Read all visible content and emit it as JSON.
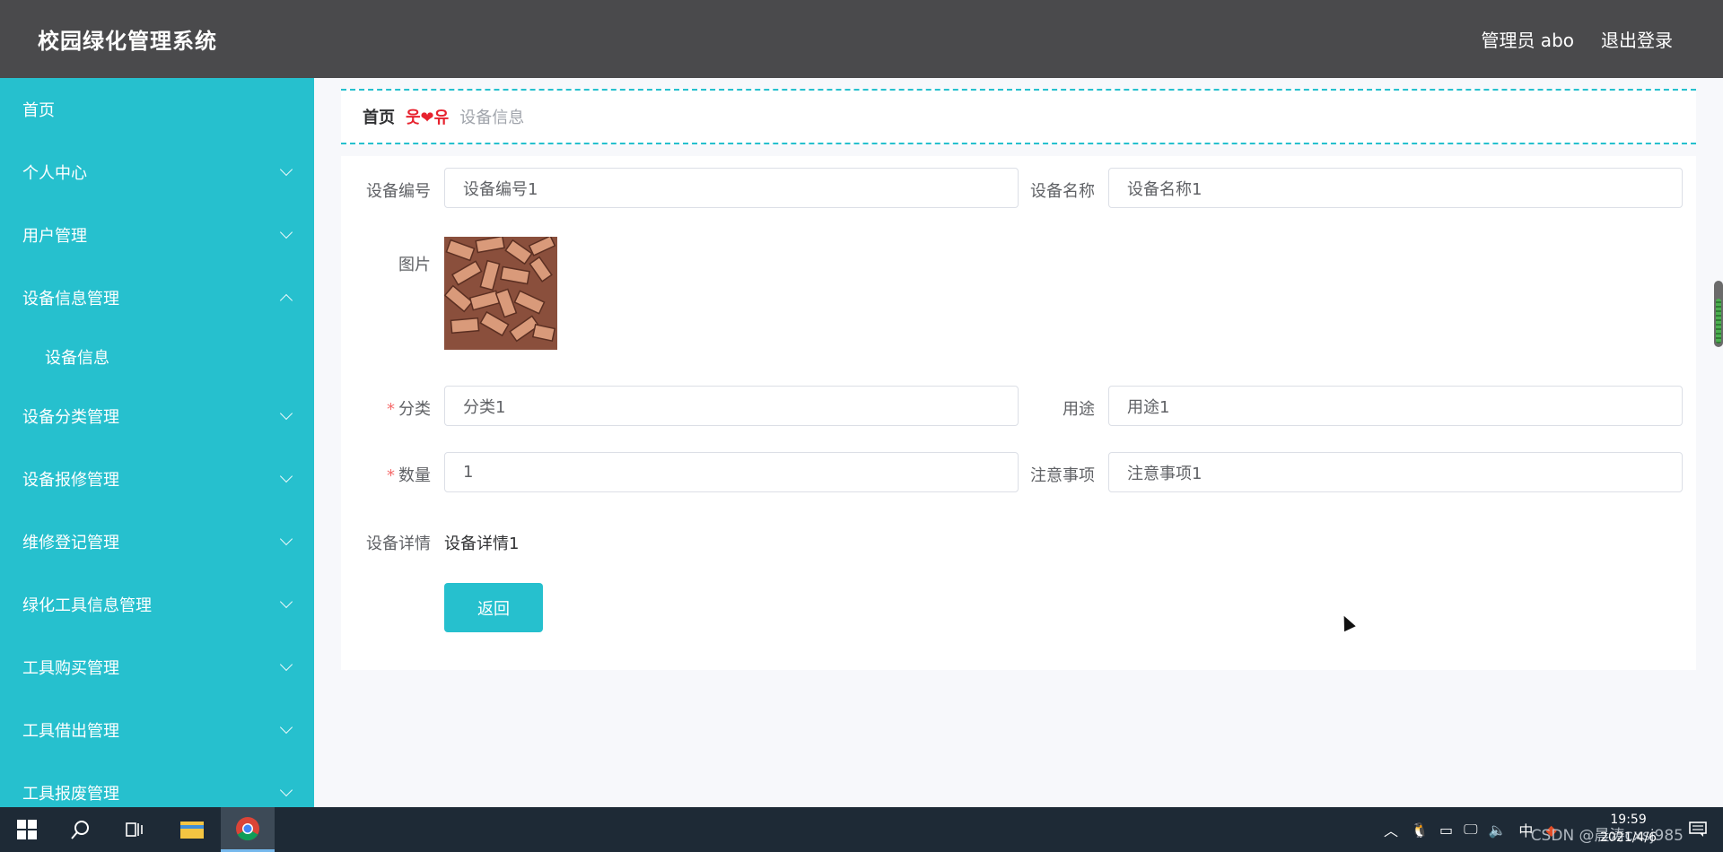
{
  "header": {
    "app_title": "校园绿化管理系统",
    "user_info": "管理员 abo",
    "logout": "退出登录"
  },
  "sidebar": {
    "items": [
      {
        "label": "首页",
        "expandable": false
      },
      {
        "label": "个人中心",
        "expandable": true
      },
      {
        "label": "用户管理",
        "expandable": true
      },
      {
        "label": "设备信息管理",
        "expandable": true,
        "expanded": true
      },
      {
        "label": "设备信息",
        "sub": true
      },
      {
        "label": "设备分类管理",
        "expandable": true
      },
      {
        "label": "设备报修管理",
        "expandable": true
      },
      {
        "label": "维修登记管理",
        "expandable": true
      },
      {
        "label": "绿化工具信息管理",
        "expandable": true
      },
      {
        "label": "工具购买管理",
        "expandable": true
      },
      {
        "label": "工具借出管理",
        "expandable": true
      },
      {
        "label": "工具报废管理",
        "expandable": true
      }
    ]
  },
  "breadcrumb": {
    "home": "首页",
    "separator": "웃❤유",
    "current": "设备信息"
  },
  "form": {
    "device_no_label": "设备编号",
    "device_no_value": "设备编号1",
    "device_name_label": "设备名称",
    "device_name_value": "设备名称1",
    "image_label": "图片",
    "category_label": "分类",
    "category_value": "分类1",
    "usage_label": "用途",
    "usage_value": "用途1",
    "quantity_label": "数量",
    "quantity_value": "1",
    "notes_label": "注意事项",
    "notes_value": "注意事项1",
    "detail_label": "设备详情",
    "detail_value": "设备详情1",
    "required_mark": "*",
    "back_button": "返回"
  },
  "taskbar": {
    "tray_lang": "中",
    "time": "19:59",
    "date": "2021/4/6",
    "watermark": "CSDN @晨涛cxsj985"
  },
  "colors": {
    "accent": "#26c0ce",
    "header_bg": "#4a4a4c",
    "required": "#f56c6c",
    "breadcrumb_separator": "#e7222e"
  }
}
